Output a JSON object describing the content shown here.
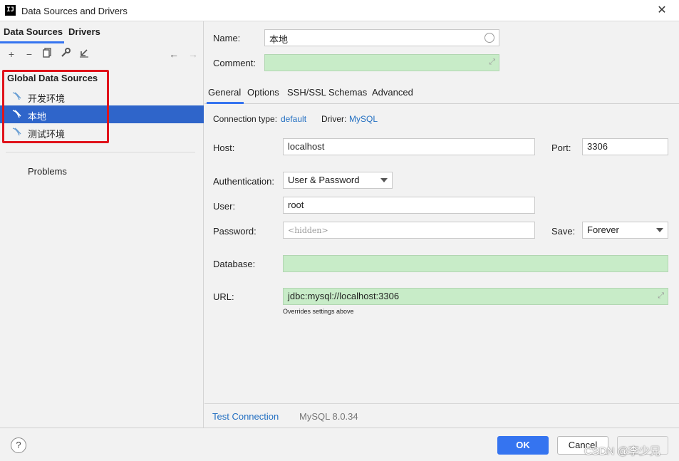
{
  "window": {
    "title": "Data Sources and Drivers",
    "logo": "IJ"
  },
  "left": {
    "tabs": [
      "Data Sources",
      "Drivers"
    ],
    "toolbar": {
      "add": "+",
      "remove": "−",
      "copy": "⧉",
      "settings": "🔧",
      "import": "↙",
      "back": "←",
      "forward": "→"
    },
    "group_title": "Global Data Sources",
    "items": [
      {
        "label": "开发环境",
        "selected": false
      },
      {
        "label": "本地",
        "selected": true
      },
      {
        "label": "测试环境",
        "selected": false
      }
    ],
    "problems": "Problems"
  },
  "form": {
    "name_label": "Name:",
    "name_value": "本地",
    "comment_label": "Comment:",
    "comment_value": "",
    "tabs": [
      "General",
      "Options",
      "SSH/SSL",
      "Schemas",
      "Advanced"
    ],
    "connection_type_label": "Connection type:",
    "connection_type_value": "default",
    "driver_label": "Driver:",
    "driver_value": "MySQL",
    "host_label": "Host:",
    "host_value": "localhost",
    "port_label": "Port:",
    "port_value": "3306",
    "auth_label": "Authentication:",
    "auth_value": "User & Password",
    "user_label": "User:",
    "user_value": "root",
    "password_label": "Password:",
    "password_placeholder": "<hidden>",
    "save_label": "Save:",
    "save_value": "Forever",
    "database_label": "Database:",
    "database_value": "",
    "url_label": "URL:",
    "url_value": "jdbc:mysql://localhost:3306",
    "url_hint": "Overrides settings above"
  },
  "bottom": {
    "test_connection": "Test Connection",
    "version": "MySQL 8.0.34"
  },
  "footer": {
    "help": "?",
    "ok": "OK",
    "cancel": "Cancel",
    "apply": "",
    "watermark": "CSDN @李少兄"
  },
  "colors": {
    "accent": "#3574f0",
    "selection": "#2f65ca",
    "highlight_box": "#e0131b",
    "green_field": "#c8ecc8"
  }
}
